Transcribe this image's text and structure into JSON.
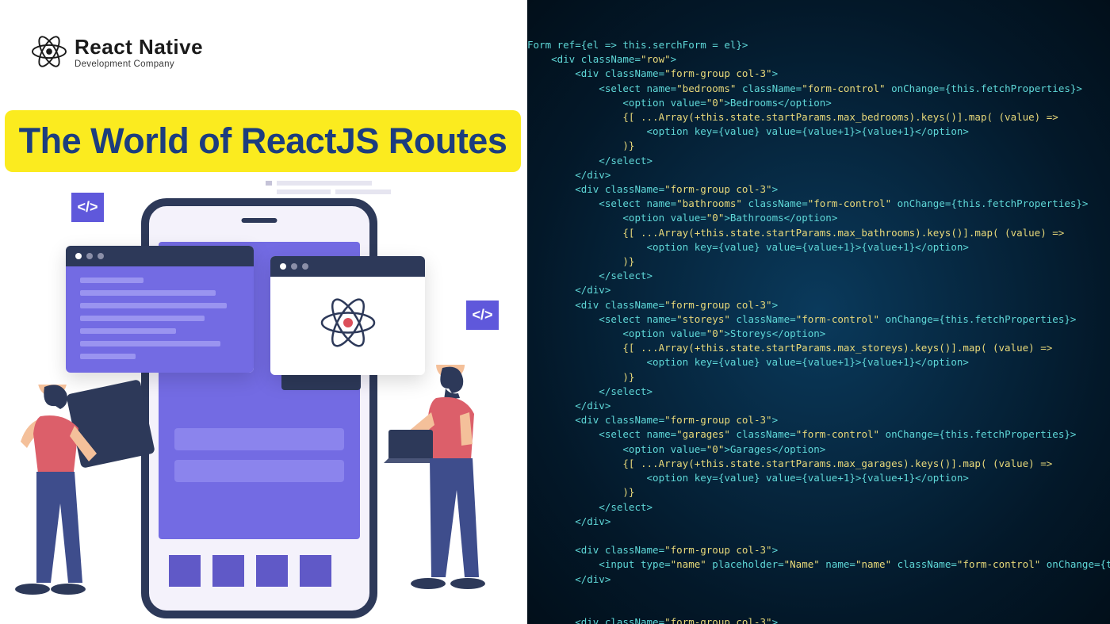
{
  "logo": {
    "title": "React Native",
    "subtitle": "Development Company"
  },
  "banner": {
    "title": "The World of ReactJS Routes"
  },
  "code": {
    "lines": [
      "Form ref={el => this.serchForm = el}>",
      "    <div className=\"row\">",
      "        <div className=\"form-group col-3\">",
      "            <select name=\"bedrooms\" className=\"form-control\" onChange={this.fetchProperties}>",
      "                <option value=\"0\">Bedrooms</option>",
      "                {[ ...Array(+this.state.startParams.max_bedrooms).keys()].map( (value) =>",
      "                    <option key={value} value={value+1}>{value+1}</option>",
      "                )}",
      "            </select>",
      "        </div>",
      "        <div className=\"form-group col-3\">",
      "            <select name=\"bathrooms\" className=\"form-control\" onChange={this.fetchProperties}>",
      "                <option value=\"0\">Bathrooms</option>",
      "                {[ ...Array(+this.state.startParams.max_bathrooms).keys()].map( (value) =>",
      "                    <option key={value} value={value+1}>{value+1}</option>",
      "                )}",
      "            </select>",
      "        </div>",
      "        <div className=\"form-group col-3\">",
      "            <select name=\"storeys\" className=\"form-control\" onChange={this.fetchProperties}>",
      "                <option value=\"0\">Storeys</option>",
      "                {[ ...Array(+this.state.startParams.max_storeys).keys()].map( (value) =>",
      "                    <option key={value} value={value+1}>{value+1}</option>",
      "                )}",
      "            </select>",
      "        </div>",
      "        <div className=\"form-group col-3\">",
      "            <select name=\"garages\" className=\"form-control\" onChange={this.fetchProperties}>",
      "                <option value=\"0\">Garages</option>",
      "                {[ ...Array(+this.state.startParams.max_garages).keys()].map( (value) =>",
      "                    <option key={value} value={value+1}>{value+1}</option>",
      "                )}",
      "            </select>",
      "        </div>",
      "",
      "        <div className=\"form-group col-3\">",
      "            <input type=\"name\" placeholder=\"Name\" name=\"name\" className=\"form-control\" onChange={this.fetchProperties} />",
      "        </div>",
      "",
      "",
      "        <div className=\"form-group col-3\">"
    ]
  },
  "colors": {
    "banner_bg": "#fbeb1f",
    "banner_text": "#1c3d7e",
    "code_bg": "#052238",
    "code_text": "#5fd8d8",
    "code_highlight": "#e8d97a"
  }
}
